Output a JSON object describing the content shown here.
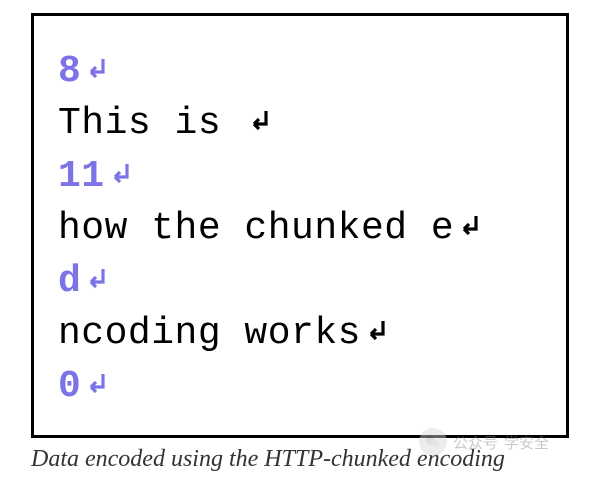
{
  "code_lines": [
    {
      "type": "size",
      "text": "8"
    },
    {
      "type": "body",
      "text": "This is "
    },
    {
      "type": "size",
      "text": "11"
    },
    {
      "type": "body",
      "text": "how the chunked e"
    },
    {
      "type": "size",
      "text": "d"
    },
    {
      "type": "body",
      "text": "ncoding works"
    },
    {
      "type": "size",
      "text": "0"
    }
  ],
  "caption": "Data encoded using the HTTP-chunked encoding",
  "colors": {
    "size": "#7b73e6",
    "body": "#000000",
    "return_glyph_size": "#7b73e6",
    "return_glyph_body": "#000000"
  },
  "watermark": {
    "label": "公众号",
    "tail": "学安全"
  }
}
